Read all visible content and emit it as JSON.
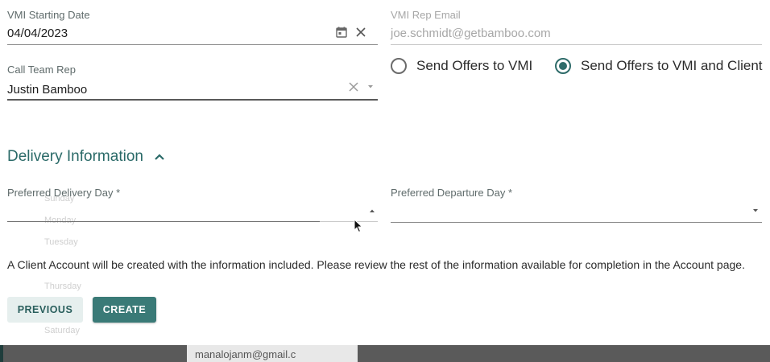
{
  "vmi_start": {
    "label": "VMI Starting Date",
    "value": "04/04/2023",
    "calendar_icon": "calendar-icon",
    "clear_icon": "close-icon"
  },
  "vmi_rep_email": {
    "label": "VMI Rep Email",
    "value": "joe.schmidt@getbamboo.com"
  },
  "call_team_rep": {
    "label": "Call Team Rep",
    "value": "Justin Bamboo",
    "clear_icon": "close-icon",
    "dropdown_icon": "caret-down-icon"
  },
  "offers": {
    "option_vmi": "Send Offers to VMI",
    "option_vmi_client": "Send Offers to VMI and Client",
    "selected": "option_vmi_client"
  },
  "delivery": {
    "title": "Delivery Information",
    "toggle_icon": "chevron-up-icon",
    "preferred_delivery_label": "Preferred Delivery Day *",
    "preferred_departure_label": "Preferred Departure Day *"
  },
  "day_options": [
    "Sunday",
    "Monday",
    "Tuesday",
    "Thursday",
    "Saturday"
  ],
  "info_message": "A Client Account will be created with the information included. Please review the rest of the information available for completion in the Account page.",
  "actions": {
    "previous_label": "PREVIOUS",
    "create_label": "CREATE"
  },
  "background": {
    "email_fragment": "manalojanm@gmail.c"
  },
  "colors": {
    "accent": "#2f6c6a",
    "primary_button": "#3a7a77",
    "secondary_button": "#e6efee"
  }
}
